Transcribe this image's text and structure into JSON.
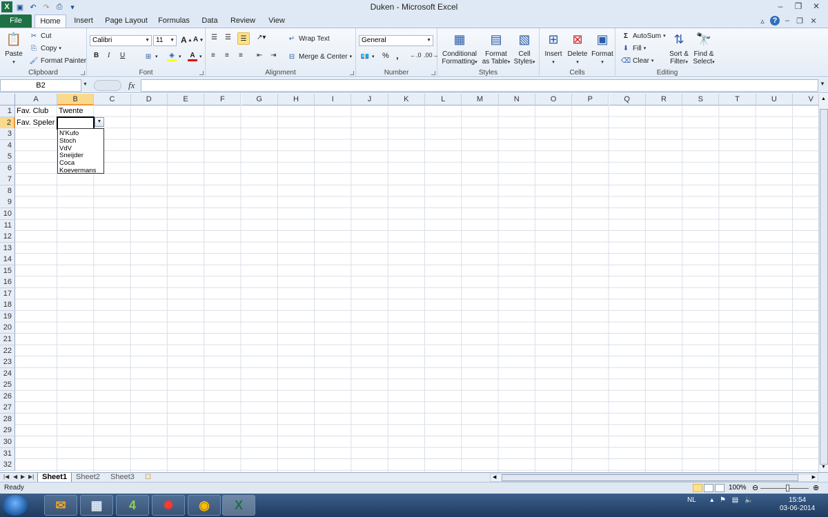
{
  "window": {
    "title": "Duken  -  Microsoft Excel"
  },
  "ribbon_tabs": [
    "File",
    "Home",
    "Insert",
    "Page Layout",
    "Formulas",
    "Data",
    "Review",
    "View"
  ],
  "clipboard": {
    "paste": "Paste",
    "cut": "Cut",
    "copy": "Copy",
    "format_painter": "Format Painter",
    "label": "Clipboard"
  },
  "font": {
    "name": "Calibri",
    "size": "11",
    "bold": "B",
    "italic": "I",
    "underline": "U",
    "grow": "A",
    "shrink": "A",
    "label": "Font"
  },
  "alignment": {
    "wrap": "Wrap Text",
    "merge": "Merge & Center",
    "label": "Alignment"
  },
  "number": {
    "format": "General",
    "percent": "%",
    "comma": ",",
    "label": "Number"
  },
  "styles": {
    "conditional_1": "Conditional",
    "conditional_2": "Formatting",
    "table_1": "Format",
    "table_2": "as Table",
    "cell_1": "Cell",
    "cell_2": "Styles",
    "label": "Styles"
  },
  "cells": {
    "insert": "Insert",
    "delete": "Delete",
    "format": "Format",
    "label": "Cells"
  },
  "editing": {
    "autosum": "AutoSum",
    "fill": "Fill",
    "clear": "Clear",
    "sort_1": "Sort &",
    "sort_2": "Filter",
    "find_1": "Find &",
    "find_2": "Select",
    "label": "Editing"
  },
  "formula_bar": {
    "name_box": "B2",
    "fx": "fx",
    "value": ""
  },
  "sheet": {
    "columns": [
      "A",
      "B",
      "C",
      "D",
      "E",
      "F",
      "G",
      "H",
      "I",
      "J",
      "K",
      "L",
      "M",
      "N",
      "O",
      "P",
      "Q",
      "R",
      "S",
      "T",
      "U",
      "V"
    ],
    "rows": [
      "1",
      "2",
      "3",
      "4",
      "5",
      "6",
      "7",
      "8",
      "9",
      "10",
      "11",
      "12",
      "13",
      "14",
      "15",
      "16",
      "17",
      "18",
      "19",
      "20",
      "21",
      "22",
      "23",
      "24",
      "25",
      "26",
      "27",
      "28",
      "29",
      "30",
      "31",
      "32"
    ],
    "selected_column": "B",
    "selected_row": "2",
    "cells": {
      "A1": "Fav. Club",
      "B1": "Twente",
      "A2": "Fav. Speler"
    }
  },
  "dropdown": {
    "items": [
      "N'Kufo",
      "Stoch",
      "VdV",
      "Sneijder",
      "Coca",
      "Koevermans"
    ]
  },
  "sheet_tabs": [
    "Sheet1",
    "Sheet2",
    "Sheet3"
  ],
  "status": {
    "text": "Ready",
    "zoom": "100%"
  },
  "taskbar": {
    "tray_lang": "NL",
    "time": "15:54",
    "date": "03-06-2014"
  },
  "colors": {
    "file_tab": "#1e7145",
    "selected_header": "#f9d98b",
    "accent": "#2a5ca8"
  }
}
